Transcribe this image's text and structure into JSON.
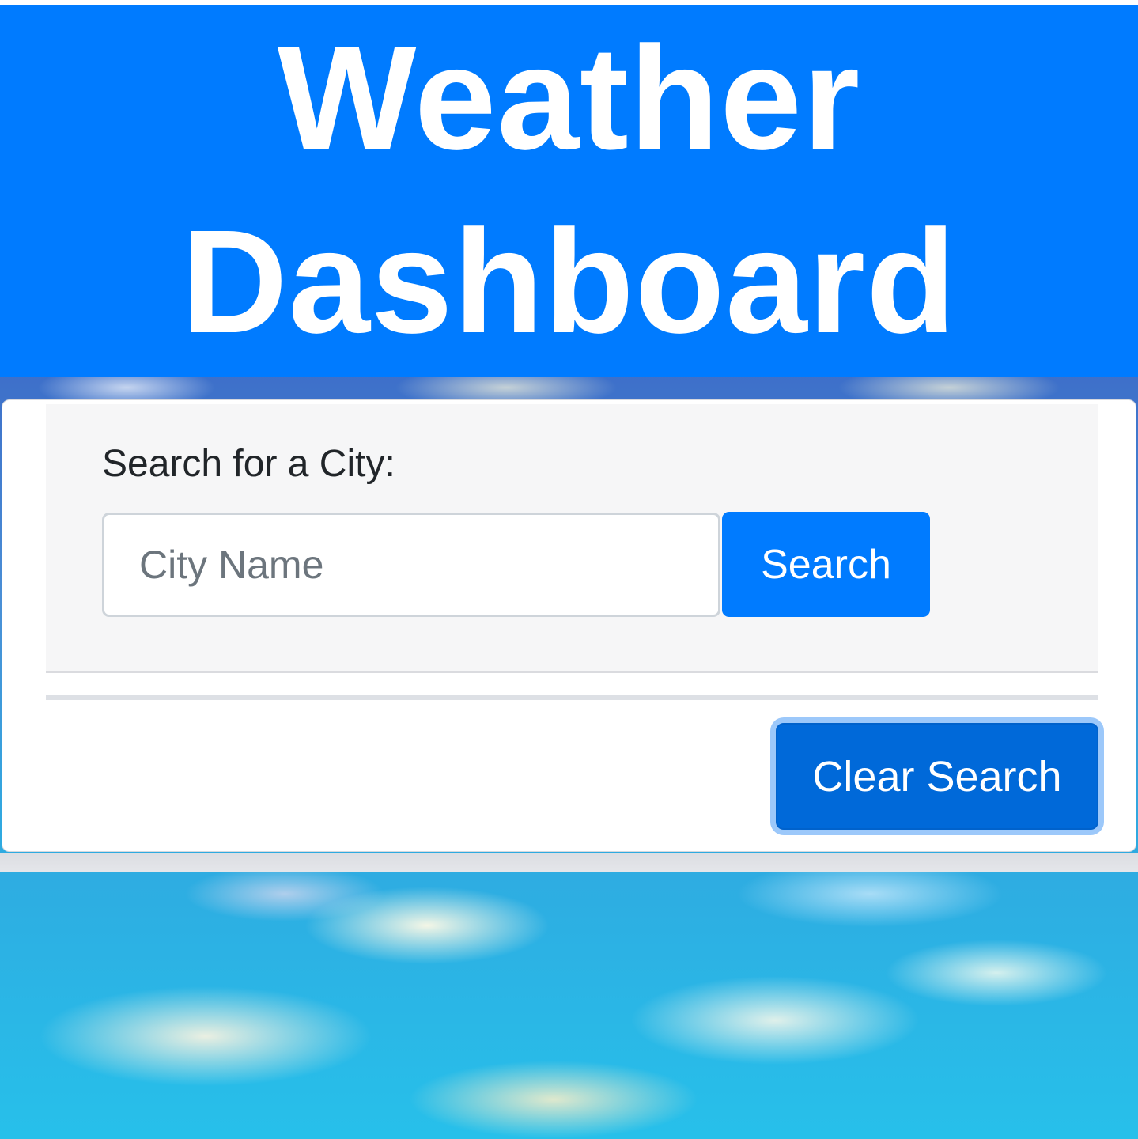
{
  "header": {
    "title": "Weather Dashboard"
  },
  "search": {
    "label": "Search for a City:",
    "input_value": "",
    "placeholder": "City Name",
    "search_button_label": "Search",
    "clear_button_label": "Clear Search"
  },
  "colors": {
    "brand_blue": "#007bff",
    "clear_button_active": "#0069d9",
    "focus_ring": "#9cc8fa",
    "panel_background": "#f6f6f7"
  },
  "icons": {
    "background": "sky-clouds-image"
  }
}
